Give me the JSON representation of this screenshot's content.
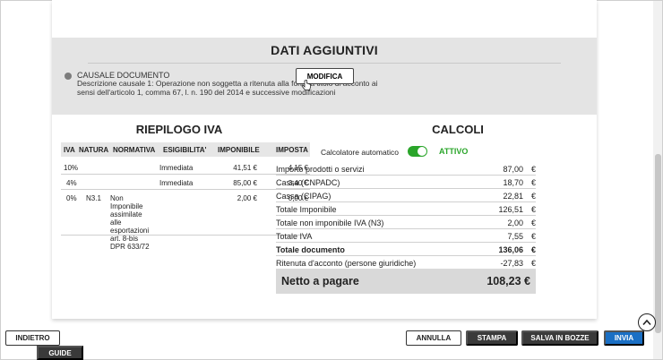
{
  "dati_aggiuntivi": {
    "title": "DATI AGGIUNTIVI",
    "causale_label": "CAUSALE DOCUMENTO",
    "causale_desc": "Descrizione causale 1: Operazione non soggetta a ritenuta alla fonte a titolo di acconto ai sensi dell'articolo 1, comma 67, l. n. 190 del 2014 e successive modificazioni",
    "modifica_label": "MODIFICA"
  },
  "riepilogo_iva": {
    "title": "RIEPILOGO IVA",
    "headers": [
      "IVA",
      "NATURA",
      "NORMATIVA",
      "ESIGIBILITA'",
      "IMPONIBILE",
      "IMPOSTA"
    ],
    "rows": [
      {
        "iva": "10%",
        "natura": "",
        "normativa": "",
        "esigibilita": "Immediata",
        "imponibile": "41,51 €",
        "imposta": "4,15 €"
      },
      {
        "iva": "4%",
        "natura": "",
        "normativa": "",
        "esigibilita": "Immediata",
        "imponibile": "85,00 €",
        "imposta": "3,40 €"
      },
      {
        "iva": "0%",
        "natura": "N3.1",
        "normativa": "Non Imponibile assimilate alle esportazioni art. 8-bis DPR 633/72",
        "esigibilita": "",
        "imponibile": "2,00 €",
        "imposta": "0,00 €"
      }
    ]
  },
  "calcoli": {
    "title": "CALCOLI",
    "auto_label": "Calcolatore automatico",
    "toggle_state": "ATTIVO",
    "rows": [
      {
        "label": "Importo prodotti o servizi",
        "value": "87,00",
        "currency": "€"
      },
      {
        "label": "Cassa (CNPADC)",
        "value": "18,70",
        "currency": "€"
      },
      {
        "label": "Cassa (CIPAG)",
        "value": "22,81",
        "currency": "€"
      },
      {
        "label": "Totale Imponibile",
        "value": "126,51",
        "currency": "€"
      },
      {
        "label": "Totale non imponibile IVA (N3)",
        "value": "2,00",
        "currency": "€"
      },
      {
        "label": "Totale IVA",
        "value": "7,55",
        "currency": "€"
      },
      {
        "label": "Totale documento",
        "value": "136,06",
        "currency": "€"
      },
      {
        "label": "Ritenuta d'acconto (persone giuridiche)",
        "value": "-27,83",
        "currency": "€"
      }
    ],
    "netto_label": "Netto a pagare",
    "netto_value": "108,23 €"
  },
  "footer": {
    "indietro": "INDIETRO",
    "guide": "GUIDE",
    "annulla": "ANNULLA",
    "stampa": "STAMPA",
    "salva": "SALVA IN BOZZE",
    "invia": "INVIA"
  },
  "colors": {
    "accent_blue": "#1a6fc4",
    "active_green": "#2aa52a",
    "dark_button": "#3a3a3a"
  }
}
